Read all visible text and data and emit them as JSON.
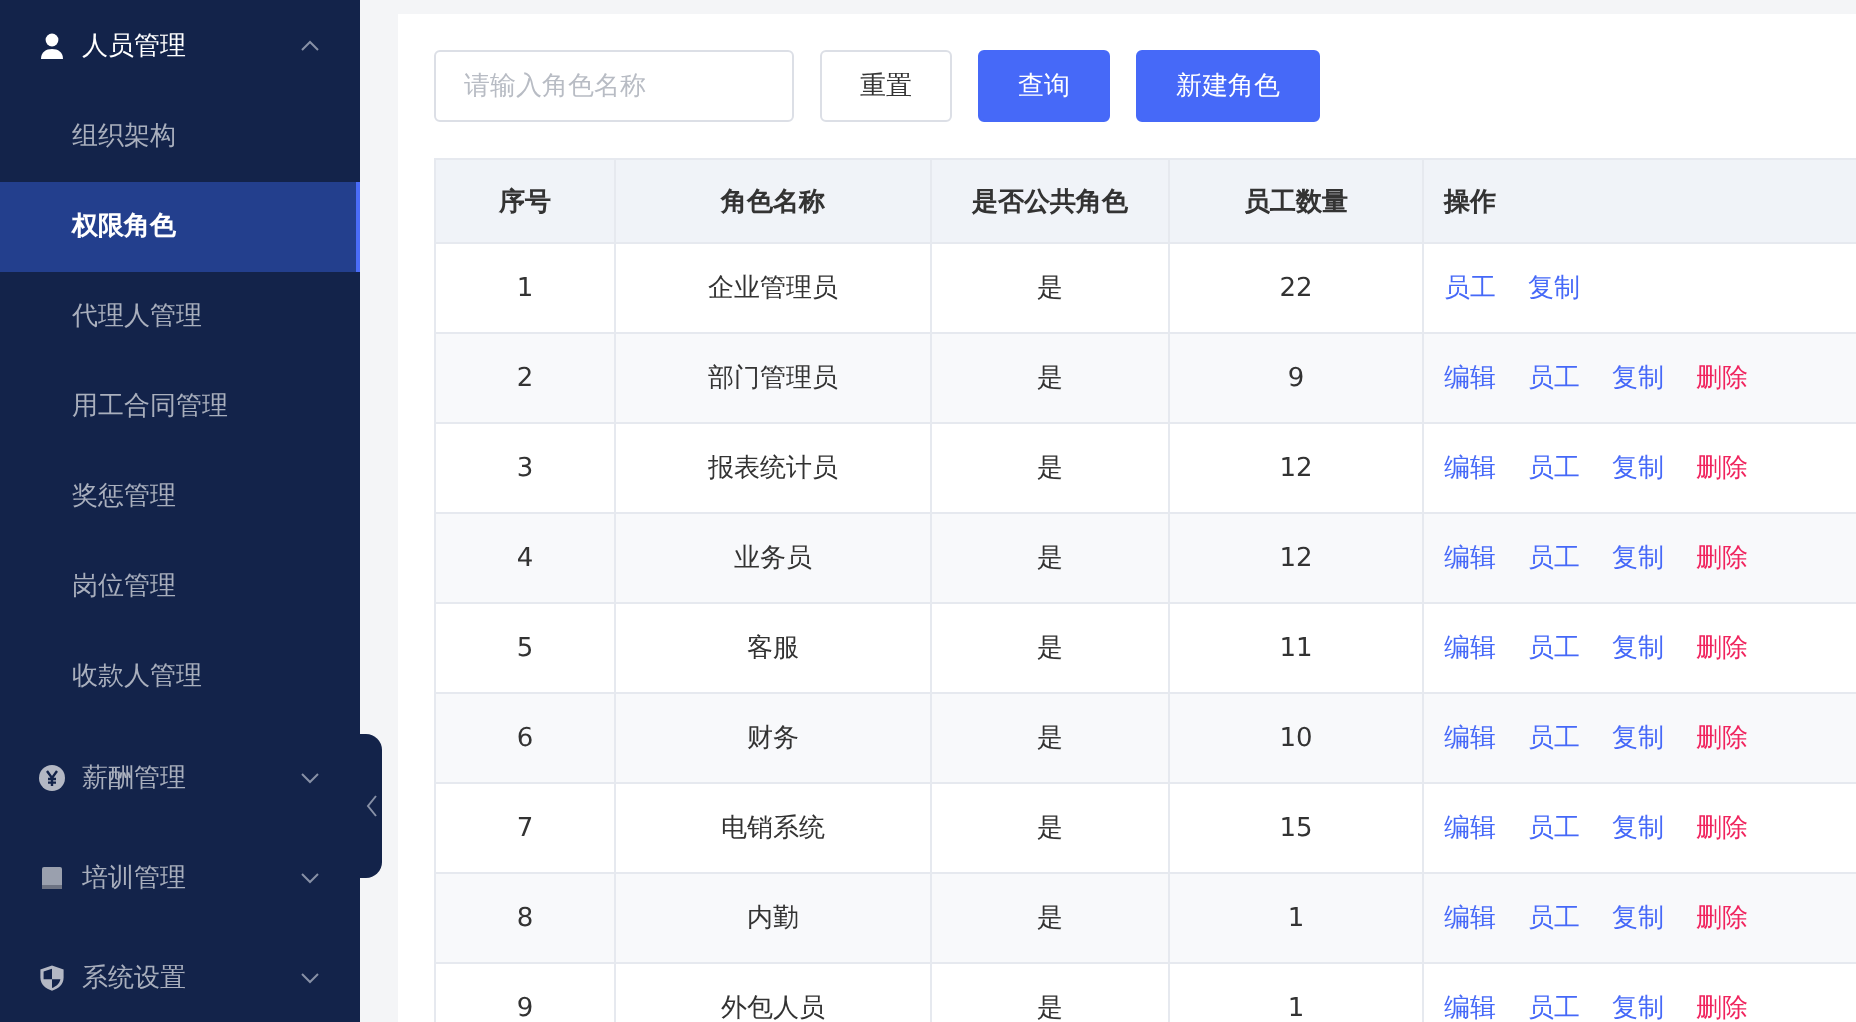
{
  "sidebar": {
    "groups": [
      {
        "label": "人员管理",
        "kind": "person",
        "expanded": true,
        "items": [
          {
            "label": "组织架构",
            "selected": false
          },
          {
            "label": "权限角色",
            "selected": true
          },
          {
            "label": "代理人管理",
            "selected": false
          },
          {
            "label": "用工合同管理",
            "selected": false
          },
          {
            "label": "奖惩管理",
            "selected": false
          },
          {
            "label": "岗位管理",
            "selected": false
          },
          {
            "label": "收款人管理",
            "selected": false
          }
        ]
      },
      {
        "label": "薪酬管理",
        "kind": "coin",
        "expanded": false
      },
      {
        "label": "培训管理",
        "kind": "book",
        "expanded": false
      },
      {
        "label": "系统设置",
        "kind": "shield",
        "expanded": false
      }
    ]
  },
  "search": {
    "placeholder": "请输入角色名称"
  },
  "buttons": [
    {
      "label": "重置",
      "kind": "plain"
    },
    {
      "label": "查询",
      "kind": "primary"
    },
    {
      "label": "新建角色",
      "kind": "primary"
    }
  ],
  "table": {
    "columns": [
      "序号",
      "角色名称",
      "是否公共角色",
      "员工数量",
      "操作"
    ],
    "rows": [
      {
        "cells": [
          "1",
          "企业管理员",
          "是",
          "22"
        ],
        "actions": [
          {
            "label": "员工",
            "kind": "link"
          },
          {
            "label": "复制",
            "kind": "link"
          }
        ]
      },
      {
        "cells": [
          "2",
          "部门管理员",
          "是",
          "9"
        ],
        "actions": [
          {
            "label": "编辑",
            "kind": "link"
          },
          {
            "label": "员工",
            "kind": "link"
          },
          {
            "label": "复制",
            "kind": "link"
          },
          {
            "label": "删除",
            "kind": "danger"
          }
        ]
      },
      {
        "cells": [
          "3",
          "报表统计员",
          "是",
          "12"
        ],
        "actions": [
          {
            "label": "编辑",
            "kind": "link"
          },
          {
            "label": "员工",
            "kind": "link"
          },
          {
            "label": "复制",
            "kind": "link"
          },
          {
            "label": "删除",
            "kind": "danger"
          }
        ]
      },
      {
        "cells": [
          "4",
          "业务员",
          "是",
          "12"
        ],
        "actions": [
          {
            "label": "编辑",
            "kind": "link"
          },
          {
            "label": "员工",
            "kind": "link"
          },
          {
            "label": "复制",
            "kind": "link"
          },
          {
            "label": "删除",
            "kind": "danger"
          }
        ]
      },
      {
        "cells": [
          "5",
          "客服",
          "是",
          "11"
        ],
        "actions": [
          {
            "label": "编辑",
            "kind": "link"
          },
          {
            "label": "员工",
            "kind": "link"
          },
          {
            "label": "复制",
            "kind": "link"
          },
          {
            "label": "删除",
            "kind": "danger"
          }
        ]
      },
      {
        "cells": [
          "6",
          "财务",
          "是",
          "10"
        ],
        "actions": [
          {
            "label": "编辑",
            "kind": "link"
          },
          {
            "label": "员工",
            "kind": "link"
          },
          {
            "label": "复制",
            "kind": "link"
          },
          {
            "label": "删除",
            "kind": "danger"
          }
        ]
      },
      {
        "cells": [
          "7",
          "电销系统",
          "是",
          "15"
        ],
        "actions": [
          {
            "label": "编辑",
            "kind": "link"
          },
          {
            "label": "员工",
            "kind": "link"
          },
          {
            "label": "复制",
            "kind": "link"
          },
          {
            "label": "删除",
            "kind": "danger"
          }
        ]
      },
      {
        "cells": [
          "8",
          "内勤",
          "是",
          "1"
        ],
        "actions": [
          {
            "label": "编辑",
            "kind": "link"
          },
          {
            "label": "员工",
            "kind": "link"
          },
          {
            "label": "复制",
            "kind": "link"
          },
          {
            "label": "删除",
            "kind": "danger"
          }
        ]
      },
      {
        "cells": [
          "9",
          "外包人员",
          "是",
          "1"
        ],
        "actions": [
          {
            "label": "编辑",
            "kind": "link"
          },
          {
            "label": "员工",
            "kind": "link"
          },
          {
            "label": "复制",
            "kind": "link"
          },
          {
            "label": "删除",
            "kind": "danger"
          }
        ]
      }
    ]
  }
}
